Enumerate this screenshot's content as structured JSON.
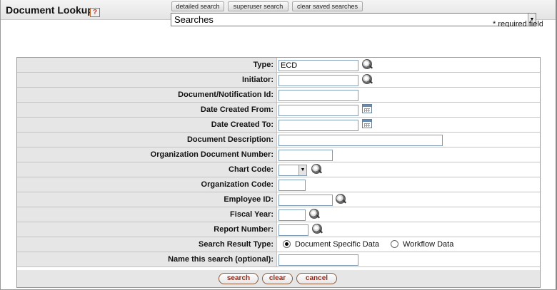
{
  "header": {
    "title": "Document Lookup",
    "help_label": "?"
  },
  "toolbar": {
    "detailed_search": "detailed search",
    "superuser_search": "superuser search",
    "clear_saved_searches": "clear saved searches"
  },
  "saved_searches": {
    "selected": "Searches"
  },
  "required_note": "* required field",
  "form": {
    "type_label": "Type:",
    "type_value": "ECD",
    "initiator_label": "Initiator:",
    "initiator_value": "",
    "doc_id_label": "Document/Notification Id:",
    "doc_id_value": "",
    "date_from_label": "Date Created From:",
    "date_from_value": "",
    "date_to_label": "Date Created To:",
    "date_to_value": "",
    "description_label": "Document Description:",
    "description_value": "",
    "org_doc_number_label": "Organization Document Number:",
    "org_doc_number_value": "",
    "chart_code_label": "Chart Code:",
    "chart_code_value": "",
    "org_code_label": "Organization Code:",
    "org_code_value": "",
    "employee_id_label": "Employee ID:",
    "employee_id_value": "",
    "fiscal_year_label": "Fiscal Year:",
    "fiscal_year_value": "",
    "report_number_label": "Report Number:",
    "report_number_value": "",
    "result_type_label": "Search Result Type:",
    "result_type_options": [
      "Document Specific Data",
      "Workflow Data"
    ],
    "result_type_selected": "Document Specific Data",
    "search_name_label": "Name this search (optional):",
    "search_name_value": ""
  },
  "actions": {
    "search": "search",
    "clear": "clear",
    "cancel": "cancel"
  }
}
